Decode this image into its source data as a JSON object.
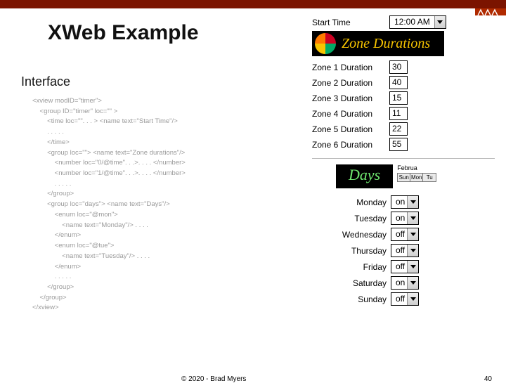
{
  "title": "XWeb Example",
  "subheading": "Interface",
  "code": "<xview modID=\"timer\">\n    <group ID=\"timer\" loc=\"\" >\n        <time loc=\"\". . . > <name text=\"Start Time\"/>\n        . . . . .\n        </time>\n        <group loc=\"\"> <name text=\"Zone durations\"/>\n            <number loc=\"0/@time\". . .>. . . . </number>\n            <number loc=\"1/@time\". . .>. . . . </number>\n            . . . . .\n        </group>\n        <group loc=\"days\"> <name text=\"Days\"/>\n            <enum loc=\"@mon\">\n                <name text=\"Monday\"/> . . . .\n            </enum>\n            <enum loc=\"@tue\">\n                <name text=\"Tuesday\"/> . . . .\n            </enum>\n            . . . . .\n        </group>\n    </group>\n</xview>",
  "start_time": {
    "label": "Start Time",
    "value": "12:00 AM"
  },
  "zone_banner": "Zone Durations",
  "zones": [
    {
      "label": "Zone 1 Duration",
      "value": "30"
    },
    {
      "label": "Zone 2 Duration",
      "value": "40"
    },
    {
      "label": "Zone 3 Duration",
      "value": "15"
    },
    {
      "label": "Zone 4 Duration",
      "value": "11"
    },
    {
      "label": "Zone 5 Duration",
      "value": "22"
    },
    {
      "label": "Zone 6 Duration",
      "value": "55"
    }
  ],
  "days_badge": "Days",
  "mini_cal": {
    "month": "Februa",
    "weekdays": [
      "Sun",
      "Mon",
      "Tu"
    ]
  },
  "days": [
    {
      "label": "Monday",
      "value": "on"
    },
    {
      "label": "Tuesday",
      "value": "on"
    },
    {
      "label": "Wednesday",
      "value": "off"
    },
    {
      "label": "Thursday",
      "value": "off"
    },
    {
      "label": "Friday",
      "value": "off"
    },
    {
      "label": "Saturday",
      "value": "on"
    },
    {
      "label": "Sunday",
      "value": "off"
    }
  ],
  "footer": {
    "copyright": "© 2020 - Brad Myers",
    "page": "40"
  }
}
